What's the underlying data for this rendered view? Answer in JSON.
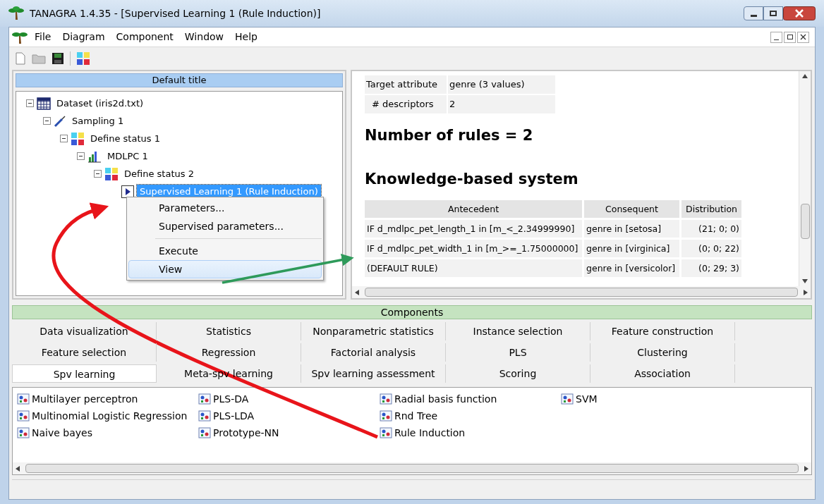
{
  "window": {
    "title": "TANAGRA 1.4.35 - [Supervised Learning 1 (Rule Induction)]"
  },
  "menu": [
    "File",
    "Diagram",
    "Component",
    "Window",
    "Help"
  ],
  "diagram": {
    "title": "Default title",
    "tree": [
      {
        "label": "Dataset (iris2d.txt)",
        "kind": "dataset",
        "expanded": true,
        "selected": false,
        "children": [
          {
            "label": "Sampling 1",
            "kind": "sampling",
            "expanded": true,
            "selected": false,
            "children": [
              {
                "label": "Define status 1",
                "kind": "status",
                "expanded": true,
                "selected": false,
                "children": [
                  {
                    "label": "MDLPC 1",
                    "kind": "discretize",
                    "expanded": true,
                    "selected": false,
                    "children": [
                      {
                        "label": "Define status 2",
                        "kind": "status",
                        "expanded": true,
                        "selected": false,
                        "children": [
                          {
                            "label": "Supervised Learning 1 (Rule Induction)",
                            "kind": "learner",
                            "selected": true
                          }
                        ]
                      }
                    ]
                  }
                ]
              }
            ]
          }
        ]
      }
    ],
    "context_menu": [
      {
        "kind": "item",
        "label": "Parameters...",
        "selected": false
      },
      {
        "kind": "item",
        "label": "Supervised parameters...",
        "selected": false
      },
      {
        "kind": "separator"
      },
      {
        "kind": "item",
        "label": "Execute",
        "selected": false
      },
      {
        "kind": "item",
        "label": "View",
        "selected": true
      }
    ]
  },
  "results": {
    "info": [
      {
        "label": "Target attribute",
        "value": "genre (3 values)"
      },
      {
        "label": "# descriptors",
        "value": "2"
      }
    ],
    "rules_count": "Number of rules = 2",
    "section_title": "Knowledge-based system",
    "table": {
      "columns": [
        "Antecedent",
        "Consequent",
        "Distribution"
      ],
      "rows": [
        [
          "IF d_mdlpc_pet_length_1 in [m_<_2.34999990]",
          "genre in [setosa]",
          "(21; 0; 0)"
        ],
        [
          "IF d_mdlpc_pet_width_1 in [m_>=_1.75000000]",
          "genre in [virginica]",
          "(0; 0; 22)"
        ],
        [
          "(DEFAULT RULE)",
          "genre in [versicolor]",
          "(0; 29; 3)"
        ]
      ]
    }
  },
  "components": {
    "title": "Components",
    "tabs": [
      [
        {
          "label": "Data visualization",
          "selected": false
        },
        {
          "label": "Statistics",
          "selected": false
        },
        {
          "label": "Nonparametric statistics",
          "selected": false
        },
        {
          "label": "Instance selection",
          "selected": false
        },
        {
          "label": "Feature construction",
          "selected": false
        }
      ],
      [
        {
          "label": "Feature selection",
          "selected": false
        },
        {
          "label": "Regression",
          "selected": false
        },
        {
          "label": "Factorial analysis",
          "selected": false
        },
        {
          "label": "PLS",
          "selected": false
        },
        {
          "label": "Clustering",
          "selected": false
        }
      ],
      [
        {
          "label": "Spv learning",
          "selected": true
        },
        {
          "label": "Meta-spv learning",
          "selected": false
        },
        {
          "label": "Spv learning assessment",
          "selected": false
        },
        {
          "label": "Scoring",
          "selected": false
        },
        {
          "label": "Association",
          "selected": false
        }
      ]
    ],
    "items": [
      [
        "Multilayer perceptron",
        "Multinomial Logistic Regression",
        "Naive bayes"
      ],
      [
        "PLS-DA",
        "PLS-LDA",
        "Prototype-NN"
      ],
      [
        "Radial basis function",
        "Rnd Tree",
        "Rule Induction"
      ],
      [
        "SVM"
      ]
    ]
  }
}
